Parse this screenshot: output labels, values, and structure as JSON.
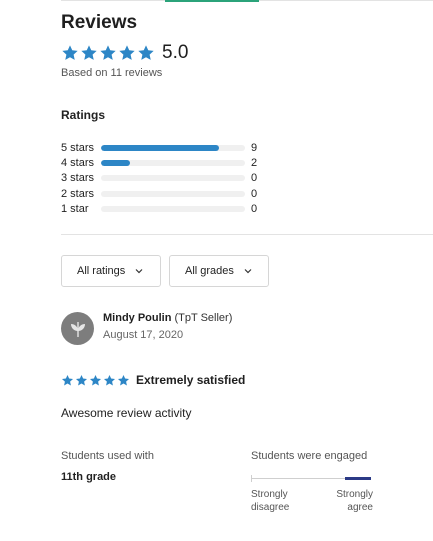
{
  "reviews": {
    "title": "Reviews",
    "average": "5.0",
    "based_on": "Based on 11 reviews",
    "star_color": "#2d86c6",
    "star_count": 5
  },
  "ratings": {
    "title": "Ratings",
    "rows": [
      {
        "label": "5 stars",
        "count": "9",
        "fraction": 0.818
      },
      {
        "label": "4 stars",
        "count": "2",
        "fraction": 0.2
      },
      {
        "label": "3 stars",
        "count": "0",
        "fraction": 0
      },
      {
        "label": "2 stars",
        "count": "0",
        "fraction": 0
      },
      {
        "label": "1 star",
        "count": "0",
        "fraction": 0
      }
    ]
  },
  "filters": {
    "ratings_label": "All ratings",
    "grades_label": "All grades",
    "chevron_icon": "chevron-down-icon"
  },
  "review": {
    "reviewer_name": "Mindy Poulin",
    "reviewer_role": "(TpT Seller)",
    "date": "August 17, 2020",
    "stars": 5,
    "headline": "Extremely satisfied",
    "body": "Awesome review activity",
    "students_used_label": "Students used with",
    "students_used_value": "11th grade",
    "engaged_label": "Students were engaged",
    "engaged_level": 1.0,
    "scale_low": "Strongly disagree",
    "scale_high": "Strongly agree",
    "avatar_icon": "avatar-icon",
    "accent_color": "#2b3a86"
  }
}
